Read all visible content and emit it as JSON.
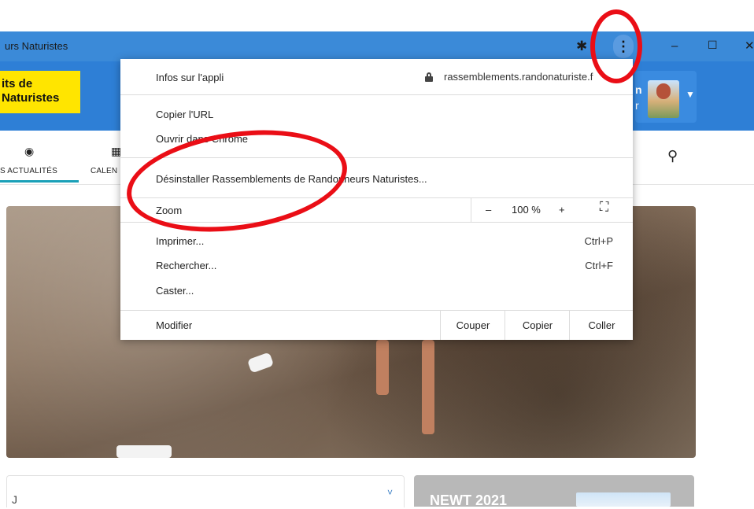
{
  "window": {
    "title": "urs Naturistes",
    "extensions_icon": "puzzle-icon",
    "menu_icon": "⋮",
    "minimize_icon": "–",
    "maximize_icon": "☐",
    "close_icon": "✕"
  },
  "header": {
    "logo_line1": "its de",
    "logo_line2": "Naturistes",
    "user_name_fragment": "n",
    "user_sub_fragment": "r"
  },
  "nav": {
    "items": [
      {
        "label": "S ACTUALITÉS",
        "icon": "dashboard-icon"
      },
      {
        "label": "CALEN",
        "icon": "calendar-icon"
      }
    ],
    "search_icon": "search-icon"
  },
  "app_menu": {
    "app_info_label": "Infos sur l'appli",
    "site_domain": "rassemblements.randonaturiste.f",
    "copy_url_label": "Copier l'URL",
    "open_in_chrome_label": "Ouvrir dans Chrome",
    "uninstall_label": "Désinstaller Rassemblements de Randonneurs Naturistes...",
    "zoom_label": "Zoom",
    "zoom_minus": "–",
    "zoom_value": "100 %",
    "zoom_plus": "+",
    "fullscreen_icon": "fullscreen-icon",
    "print_label": "Imprimer...",
    "print_shortcut": "Ctrl+P",
    "find_label": "Rechercher...",
    "find_shortcut": "Ctrl+F",
    "cast_label": "Caster...",
    "edit_label": "Modifier",
    "cut_label": "Couper",
    "copy_label": "Copier",
    "paste_label": "Coller"
  },
  "content": {
    "card_title_fragment": "J",
    "card_chevron": "˅",
    "newt_title": "NEWT 2021"
  },
  "annotations": {
    "color": "#ea0e16"
  }
}
